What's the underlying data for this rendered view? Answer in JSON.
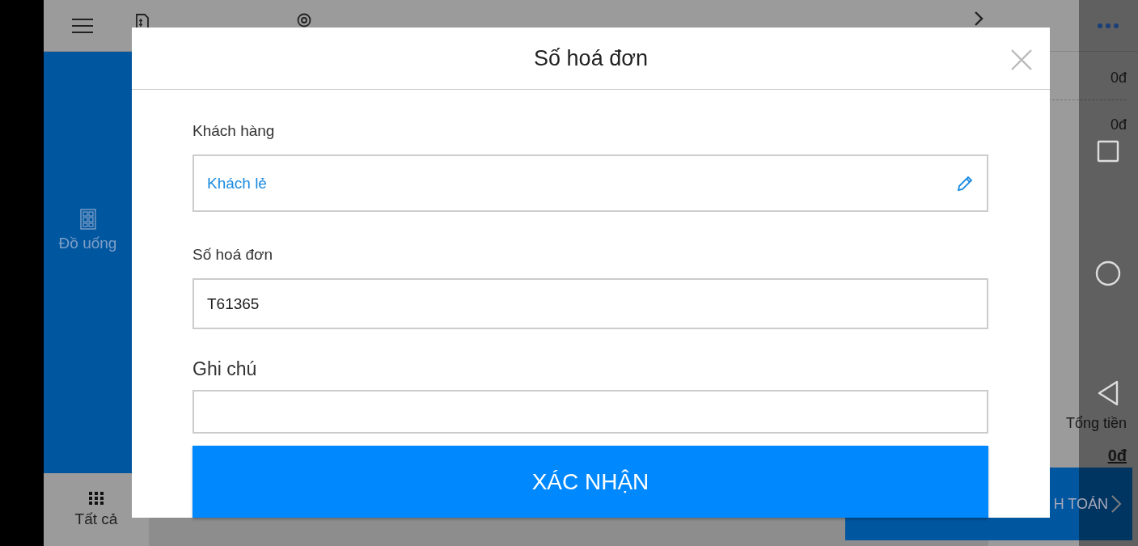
{
  "sidebar": {
    "categories": [
      {
        "label": "Đồ uống"
      }
    ],
    "all_label": "Tất cả"
  },
  "order_panel": {
    "amounts": [
      "0đ",
      "0đ"
    ],
    "total_label": "Tổng tiền",
    "total": "0đ",
    "pay_button": "H TOÁN"
  },
  "dialog": {
    "title": "Số hoá đơn",
    "fields": [
      {
        "label": "Khách hàng",
        "value": "Khách lẻ",
        "kind": "customer"
      },
      {
        "label": "Số hoá đơn",
        "value": "T61365",
        "kind": "text"
      },
      {
        "label": "Ghi chú",
        "kind": "note"
      }
    ],
    "confirm": "XÁC NHẬN"
  }
}
